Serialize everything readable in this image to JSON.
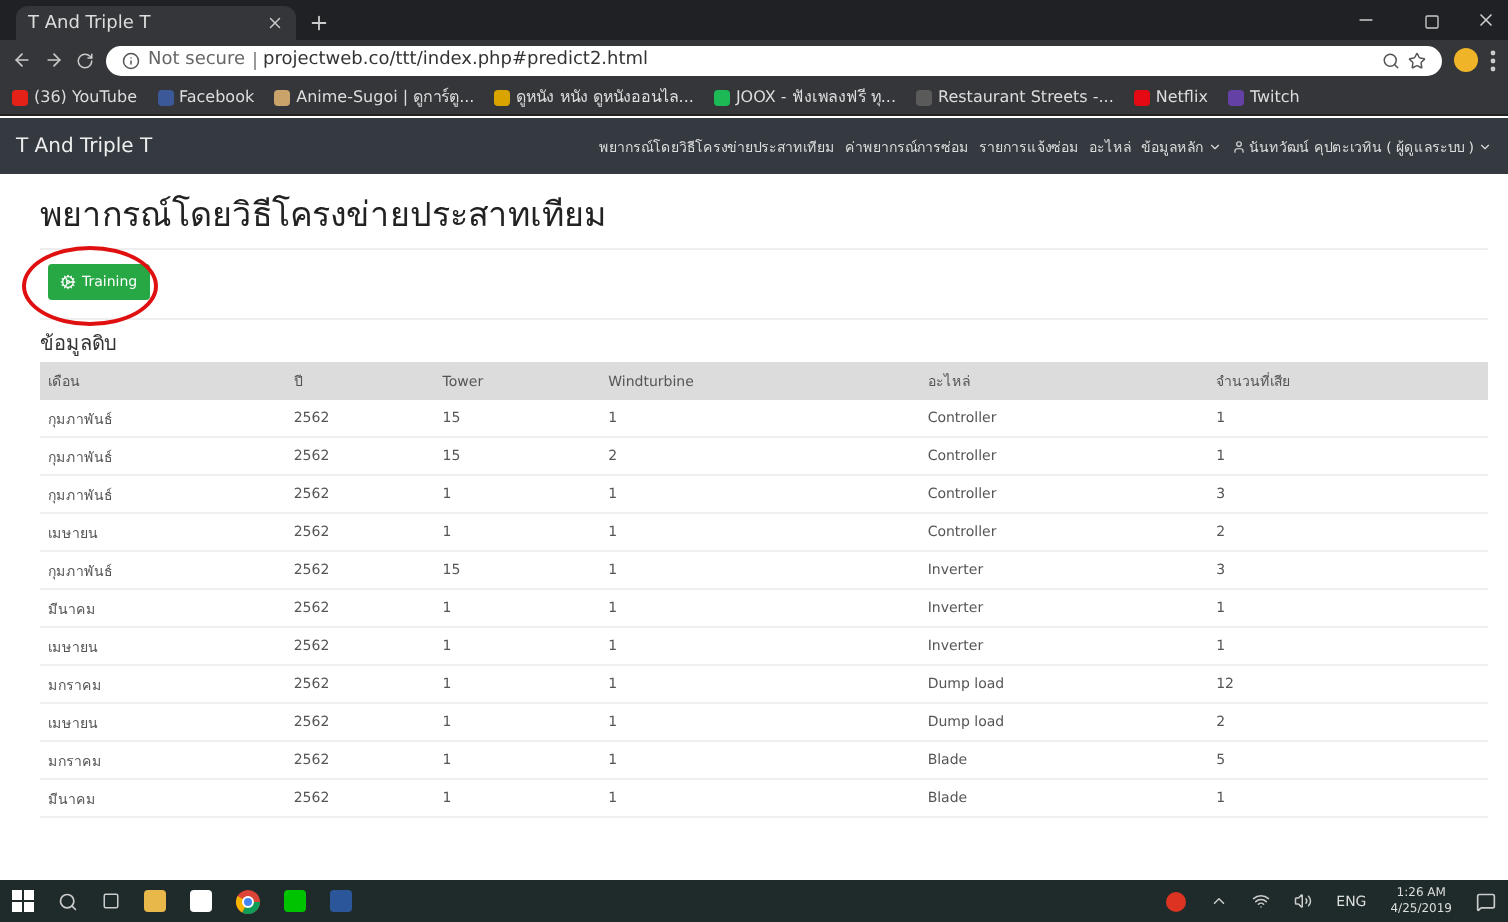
{
  "browser": {
    "tab_title": "T And Triple T",
    "security": "Not secure",
    "url": "projectweb.co/ttt/index.php#predict2.html",
    "bookmarks": [
      {
        "label": "(36) YouTube",
        "color": "#e62117"
      },
      {
        "label": "Facebook",
        "color": "#3b5998"
      },
      {
        "label": "Anime-Sugoi | ดูการ์ตู...",
        "color": "#c9a36a"
      },
      {
        "label": "ดูหนัง หนัง ดูหนังออนไล...",
        "color": "#d9a400"
      },
      {
        "label": "JOOX - ฟังเพลงฟรี ทุ...",
        "color": "#1db954"
      },
      {
        "label": "Restaurant Streets -...",
        "color": "#5a5a5a"
      },
      {
        "label": "Netflix",
        "color": "#e50914"
      },
      {
        "label": "Twitch",
        "color": "#6441a5"
      }
    ]
  },
  "navbar": {
    "brand": "T And Triple T",
    "items": [
      {
        "label": "พยากรณ์โดยวิธีโครงข่ายประสาทเทียม",
        "kind": "link"
      },
      {
        "label": "ค่าพยากรณ์การซ่อม",
        "kind": "link"
      },
      {
        "label": "รายการแจ้งซ่อม",
        "kind": "link"
      },
      {
        "label": "อะไหล่",
        "kind": "link"
      },
      {
        "label": "ข้อมูลหลัก",
        "kind": "dropdown"
      },
      {
        "label": "นันทวัฒน์ คุปตะเวทิน ( ผู้ดูแลระบบ )",
        "kind": "user"
      }
    ]
  },
  "page": {
    "title": "พยากรณ์โดยวิธีโครงข่ายประสาทเทียม",
    "button": "Training",
    "section_label": "ข้อมูลดิบ",
    "table": {
      "columns": [
        "เดือน",
        "ปี",
        "Tower",
        "Windturbine",
        "อะไหล่",
        "จำนวนที่เสีย"
      ],
      "rows": [
        [
          "กุมภาพันธ์",
          "2562",
          "15",
          "1",
          "Controller",
          "1"
        ],
        [
          "กุมภาพันธ์",
          "2562",
          "15",
          "2",
          "Controller",
          "1"
        ],
        [
          "กุมภาพันธ์",
          "2562",
          "1",
          "1",
          "Controller",
          "3"
        ],
        [
          "เมษายน",
          "2562",
          "1",
          "1",
          "Controller",
          "2"
        ],
        [
          "กุมภาพันธ์",
          "2562",
          "15",
          "1",
          "Inverter",
          "3"
        ],
        [
          "มีนาคม",
          "2562",
          "1",
          "1",
          "Inverter",
          "1"
        ],
        [
          "เมษายน",
          "2562",
          "1",
          "1",
          "Inverter",
          "1"
        ],
        [
          "มกราคม",
          "2562",
          "1",
          "1",
          "Dump load",
          "12"
        ],
        [
          "เมษายน",
          "2562",
          "1",
          "1",
          "Dump load",
          "2"
        ],
        [
          "มกราคม",
          "2562",
          "1",
          "1",
          "Blade",
          "5"
        ],
        [
          "มีนาคม",
          "2562",
          "1",
          "1",
          "Blade",
          "1"
        ]
      ]
    }
  },
  "taskbar": {
    "language": "ENG",
    "time": "1:26 AM",
    "date": "4/25/2019"
  }
}
